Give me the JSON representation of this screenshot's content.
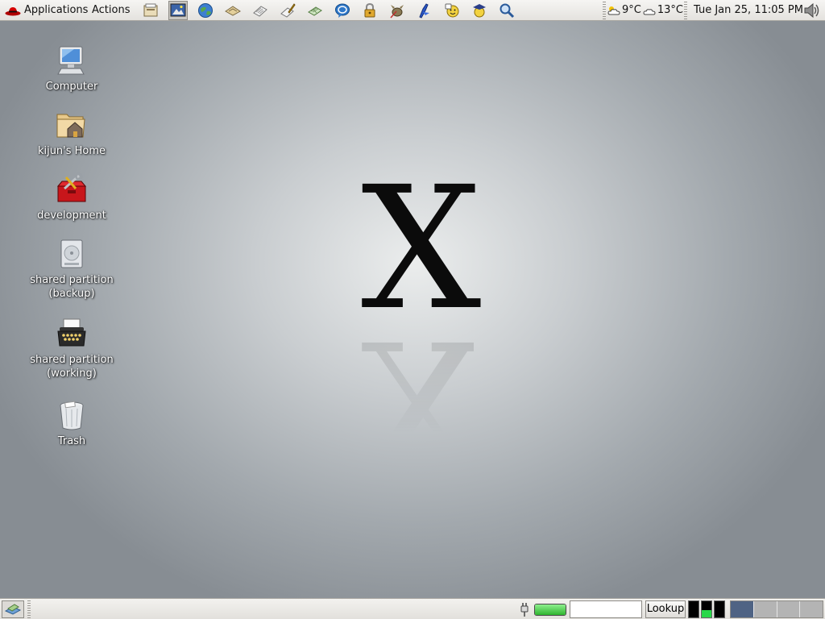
{
  "top_panel": {
    "menus": {
      "applications": "Applications",
      "actions": "Actions"
    },
    "launchers": [
      {
        "icon": "file-manager-icon"
      },
      {
        "icon": "screenshot-icon",
        "active": true
      },
      {
        "icon": "web-browser-icon"
      },
      {
        "icon": "email-icon"
      },
      {
        "icon": "writer-icon"
      },
      {
        "icon": "draw-icon"
      },
      {
        "icon": "spreadsheet-icon"
      },
      {
        "icon": "chat-icon"
      },
      {
        "icon": "lock-icon"
      },
      {
        "icon": "gimp-icon"
      },
      {
        "icon": "pen-icon"
      },
      {
        "icon": "messenger-icon"
      },
      {
        "icon": "graduation-icon"
      },
      {
        "icon": "search-icon"
      }
    ],
    "weather": {
      "temp1": "9°C",
      "temp2": "13°C"
    },
    "clock": "Tue Jan 25, 11:05 PM"
  },
  "desktop": {
    "logo": "X",
    "icons": [
      {
        "label": "Computer",
        "icon": "computer-icon"
      },
      {
        "label": "kijun's Home",
        "icon": "home-folder-icon"
      },
      {
        "label": "development",
        "icon": "toolbox-icon"
      },
      {
        "label": "shared partition\n(backup)",
        "icon": "hard-drive-icon"
      },
      {
        "label": "shared partition\n(working)",
        "icon": "typewriter-icon"
      },
      {
        "label": "Trash",
        "icon": "trash-icon"
      }
    ]
  },
  "bottom_panel": {
    "battery": {
      "level": 1.0,
      "color": "#2fb52f"
    },
    "dictionary": {
      "value": "",
      "button": "Lookup"
    },
    "system_monitor": {
      "cpu": 0.0,
      "mem": 0.45,
      "net": 0.0
    },
    "workspaces": {
      "count": 4,
      "active": 1
    }
  },
  "colors": {
    "panel": "#e4e2de",
    "desktop_center": "#ebeded",
    "desktop_edge": "#878d93",
    "workspace_active": "#4f6384"
  }
}
